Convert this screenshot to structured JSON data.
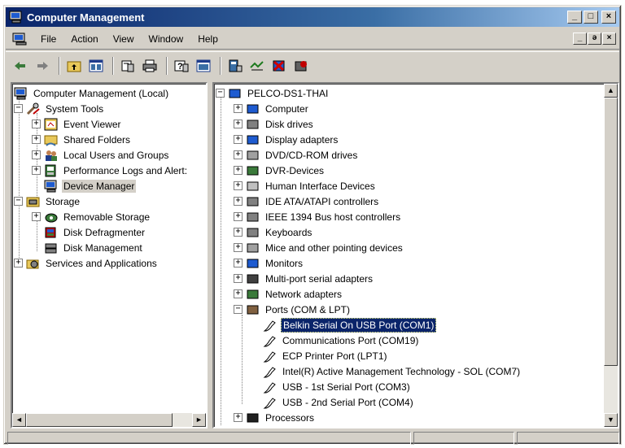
{
  "window": {
    "title": "Computer Management",
    "caption_buttons": [
      "_",
      "□",
      "×"
    ],
    "mdi_caption_buttons": [
      "_",
      "ə",
      "×"
    ]
  },
  "menu": {
    "items": [
      "File",
      "Action",
      "View",
      "Window",
      "Help"
    ]
  },
  "toolbar": {
    "icons": [
      "back-icon",
      "forward-icon",
      "up-folder-icon",
      "show-hide-tree-icon",
      "properties-icon",
      "print-icon",
      "help-icon",
      "console-view-icon",
      "scan-hardware-icon",
      "update-driver-icon",
      "uninstall-icon",
      "disable-device-icon"
    ]
  },
  "tree": {
    "root": "Computer Management (Local)",
    "system_tools": "System Tools",
    "system_tools_children": [
      "Event Viewer",
      "Shared Folders",
      "Local Users and Groups",
      "Performance Logs and Alert:",
      "Device Manager"
    ],
    "storage": "Storage",
    "storage_children": [
      "Removable Storage",
      "Disk Defragmenter",
      "Disk Management"
    ],
    "services": "Services and Applications",
    "expanders": {
      "expanded": "−",
      "collapsed": "+"
    }
  },
  "devices": {
    "root": "PELCO-DS1-THAI",
    "categories": [
      "Computer",
      "Disk drives",
      "Display adapters",
      "DVD/CD-ROM drives",
      "DVR-Devices",
      "Human Interface Devices",
      "IDE ATA/ATAPI controllers",
      "IEEE 1394 Bus host controllers",
      "Keyboards",
      "Mice and other pointing devices",
      "Monitors",
      "Multi-port serial adapters",
      "Network adapters",
      "Ports (COM & LPT)"
    ],
    "ports": [
      "Belkin Serial On USB Port (COM1)",
      "Communications Port (COM19)",
      "ECP Printer Port (LPT1)",
      "Intel(R) Active Management Technology - SOL (COM7)",
      "USB - 1st Serial Port (COM3)",
      "USB - 2nd Serial Port (COM4)"
    ],
    "after": [
      "Processors"
    ]
  },
  "scroll": {
    "up": "▲",
    "down": "▼",
    "left": "◄",
    "right": "►"
  },
  "colors": {
    "title_start": "#0a246a",
    "selection": "#0a246a",
    "face": "#d4d0c8"
  }
}
